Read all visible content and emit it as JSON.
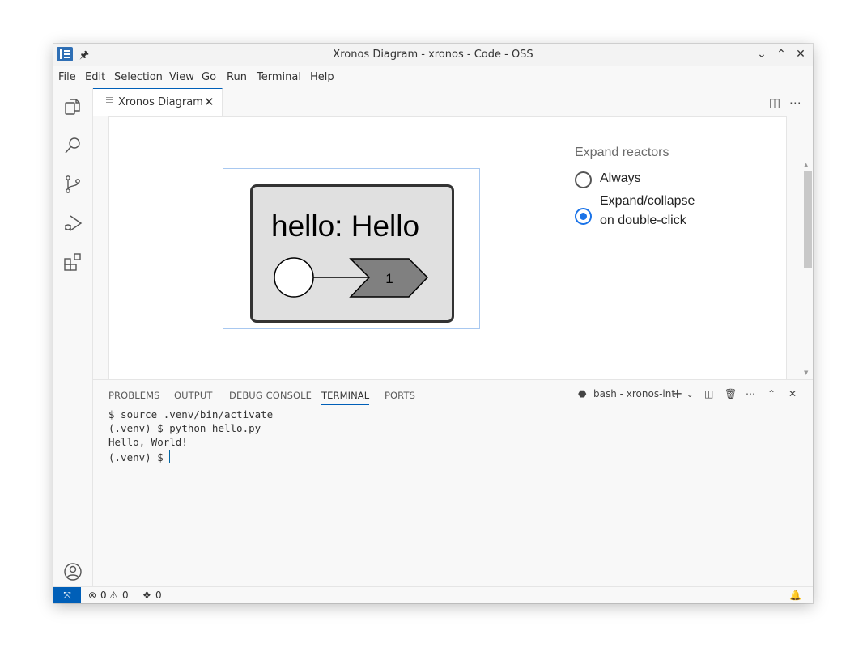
{
  "window": {
    "title": "Xronos Diagram - xronos - Code - OSS",
    "controls": [
      "minimize",
      "maximize",
      "close"
    ]
  },
  "menu": [
    "File",
    "Edit",
    "Selection",
    "View",
    "Go",
    "Run",
    "Terminal",
    "Help"
  ],
  "activity_bar": {
    "top": [
      "explorer-icon",
      "search-icon",
      "source-control-icon",
      "run-debug-icon",
      "extensions-icon"
    ],
    "bottom": [
      "account-icon",
      "manage-gear-icon"
    ]
  },
  "editor": {
    "tab_label": "Xronos Diagram",
    "diagram": {
      "reactor_label": "hello: Hello",
      "port_label": "1"
    },
    "options": {
      "title": "Expand reactors",
      "always_label": "Always",
      "expand_label_line1": "Expand/collapse",
      "expand_label_line2": "on double-click",
      "selected": "expand_on_double_click"
    }
  },
  "panel": {
    "tabs": [
      "PROBLEMS",
      "OUTPUT",
      "DEBUG CONSOLE",
      "TERMINAL",
      "PORTS"
    ],
    "active_tab": "TERMINAL",
    "terminal_name": "bash - xronos-int",
    "terminal_lines": [
      "$ source .venv/bin/activate",
      "(.venv) $ python hello.py",
      "Hello, World!",
      "(.venv) $ "
    ]
  },
  "status": {
    "errors": "0",
    "warnings": "0",
    "ports": "0"
  },
  "colors": {
    "accent": "#005fb8",
    "radio_checked": "#1a73e8",
    "reactor_fill": "#e0e0e0",
    "port_fill": "#808080"
  }
}
